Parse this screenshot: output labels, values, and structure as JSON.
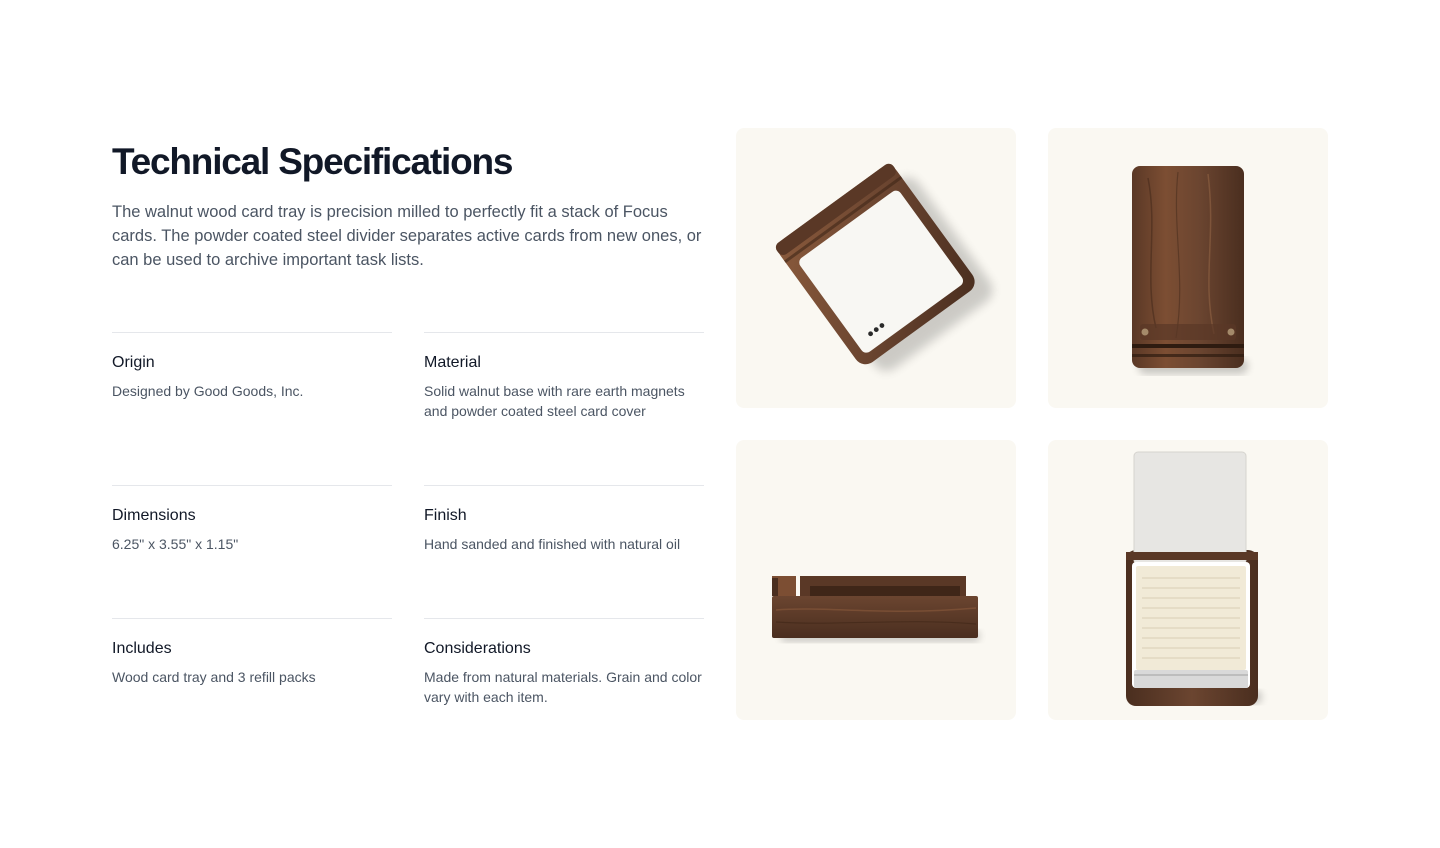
{
  "header": {
    "title": "Technical Specifications",
    "description": "The walnut wood card tray is precision milled to perfectly fit a stack of Focus cards. The powder coated steel divider separates active cards from new ones, or can be used to archive important task lists."
  },
  "specs": [
    {
      "label": "Origin",
      "value": "Designed by Good Goods, Inc."
    },
    {
      "label": "Material",
      "value": "Solid walnut base with rare earth magnets and powder coated steel card cover"
    },
    {
      "label": "Dimensions",
      "value": "6.25\" x 3.55\" x 1.15\""
    },
    {
      "label": "Finish",
      "value": "Hand sanded and finished with natural oil"
    },
    {
      "label": "Includes",
      "value": "Wood card tray and 3 refill packs"
    },
    {
      "label": "Considerations",
      "value": "Made from natural materials. Grain and color vary with each item."
    }
  ],
  "images": [
    {
      "name": "angled-tray-with-card-image"
    },
    {
      "name": "tray-top-view-image"
    },
    {
      "name": "tray-side-view-image"
    },
    {
      "name": "tray-with-cards-image"
    }
  ],
  "colors": {
    "background": "#ffffff",
    "tile_background": "#faf8f2",
    "walnut": "#6b4530",
    "walnut_dark": "#4a2e1f",
    "walnut_light": "#8a5a3c",
    "card": "#f8f7f3",
    "divider": "#e5e7eb",
    "title": "#111827",
    "body_text": "#4b5563"
  }
}
